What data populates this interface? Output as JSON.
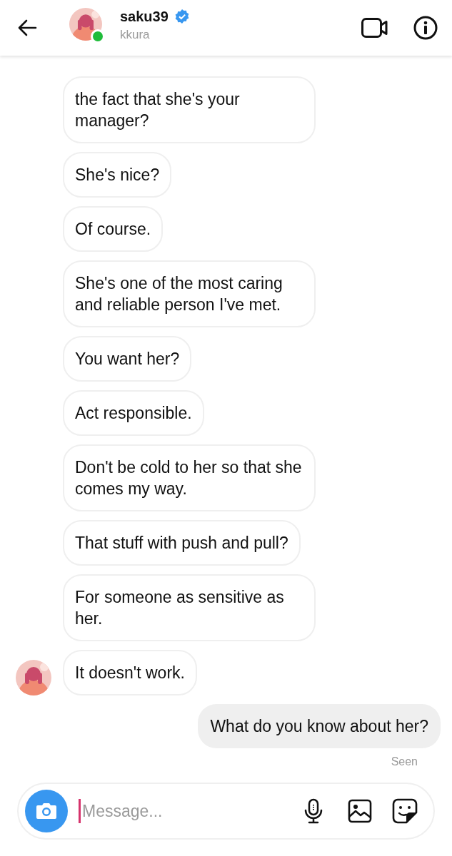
{
  "header": {
    "username": "saku39",
    "verified": true,
    "subtitle": "kkura",
    "online": true
  },
  "messages": [
    {
      "kind": "received",
      "avatar": false,
      "text": "the fact that she's your manager?"
    },
    {
      "kind": "received",
      "avatar": false,
      "text": "She's nice?"
    },
    {
      "kind": "received",
      "avatar": false,
      "text": "Of course."
    },
    {
      "kind": "received",
      "avatar": false,
      "text": "She's one of the most caring and reliable person I've met."
    },
    {
      "kind": "received",
      "avatar": false,
      "text": "You want her?"
    },
    {
      "kind": "received",
      "avatar": false,
      "text": "Act responsible."
    },
    {
      "kind": "received",
      "avatar": false,
      "text": "Don't be cold to her so that she comes my way."
    },
    {
      "kind": "received",
      "avatar": false,
      "text": "That stuff with push and pull?"
    },
    {
      "kind": "received",
      "avatar": false,
      "text": "For someone as sensitive as her."
    },
    {
      "kind": "received",
      "avatar": true,
      "text": "It doesn't work."
    },
    {
      "kind": "sent",
      "avatar": false,
      "text": "What do you know about her?"
    }
  ],
  "seen": "Seen",
  "composer": {
    "placeholder": "Message..."
  }
}
